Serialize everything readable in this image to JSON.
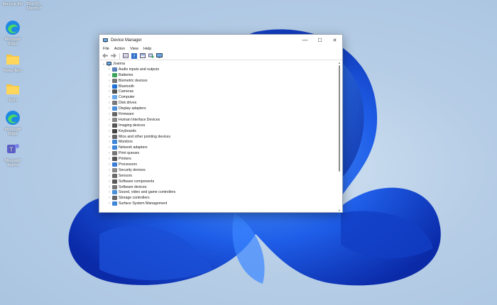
{
  "desktop": {
    "icons": [
      {
        "label": "Recycle Bin",
        "icon": "recycle-bin-icon"
      },
      {
        "label": "This PC - Shortcut",
        "icon": "this-pc-icon"
      },
      {
        "label": "Microsoft Edge",
        "icon": "edge-icon"
      },
      {
        "label": "Make Tech",
        "icon": "folder-icon"
      },
      {
        "label": "Tools",
        "icon": "folder-icon"
      },
      {
        "label": "Microsoft Edge",
        "icon": "edge-icon"
      },
      {
        "label": "Microsoft Teams",
        "icon": "teams-icon"
      }
    ]
  },
  "window": {
    "title": "Device Manager",
    "controls": {
      "minimize": "—",
      "maximize": "☐",
      "close": "✕"
    },
    "menu": [
      "File",
      "Action",
      "View",
      "Help"
    ],
    "toolbar": [
      "back-icon",
      "forward-icon",
      "properties-icon",
      "help-icon",
      "show-hidden-icon",
      "scan-hardware-icon",
      "monitor-icon"
    ],
    "tree": {
      "root": "Joanna",
      "items": [
        "Audio inputs and outputs",
        "Batteries",
        "Biometric devices",
        "Bluetooth",
        "Cameras",
        "Computer",
        "Disk drives",
        "Display adapters",
        "Firmware",
        "Human Interface Devices",
        "Imaging devices",
        "Keyboards",
        "Mice and other pointing devices",
        "Monitors",
        "Network adapters",
        "Print queues",
        "Printers",
        "Processors",
        "Security devices",
        "Sensors",
        "Software components",
        "Software devices",
        "Sound, video and game controllers",
        "Storage controllers",
        "Surface System Management"
      ]
    }
  },
  "colors": {
    "accent": "#0067c0",
    "bloom_dark": "#0a2fb8",
    "bloom_light": "#2f7bf0"
  }
}
